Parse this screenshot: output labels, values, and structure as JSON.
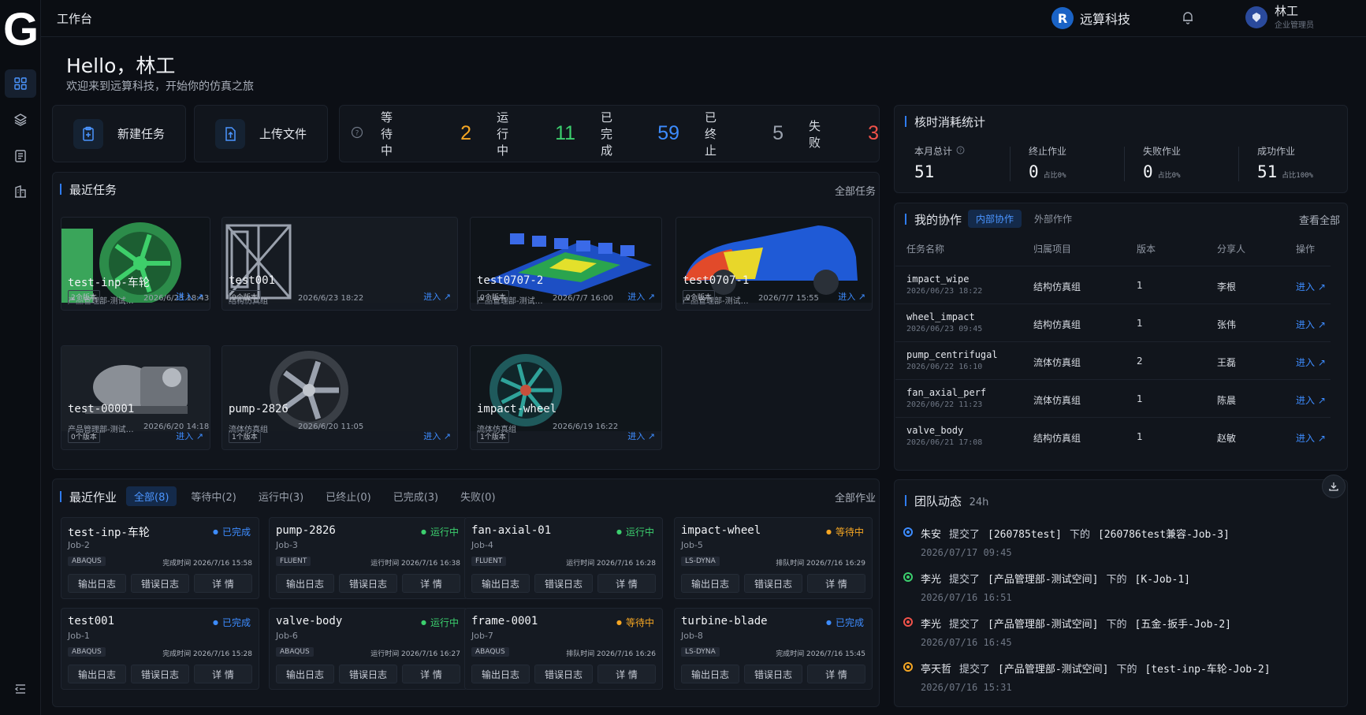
{
  "header": {
    "title": "工作台",
    "brand": "远算科技",
    "brand_logo": "R",
    "user_name": "林工",
    "user_role": "企业管理员"
  },
  "greeting": {
    "hello": "Hello，林工",
    "welcome": "欢迎来到远算科技，开始你的仿真之旅"
  },
  "actions": {
    "new_task": "新建任务",
    "upload": "上传文件"
  },
  "status": [
    {
      "label": "等待中",
      "value": "2",
      "color": "#f5a623"
    },
    {
      "label": "运行中",
      "value": "11",
      "color": "#3ccf6e"
    },
    {
      "label": "已完成",
      "value": "59",
      "color": "#3d8cff"
    },
    {
      "label": "已终止",
      "value": "5",
      "color": "#9aa1ad"
    },
    {
      "label": "失败",
      "value": "3",
      "color": "#f0524a"
    }
  ],
  "recent_tasks": {
    "title": "最近任务",
    "all_link": "全部任务",
    "enter": "进入 ↗",
    "items": [
      {
        "name": "test-inp-车轮",
        "group": "产品管理部-测试…",
        "date": "2026/6/23 18:43",
        "versions": "2个版本"
      },
      {
        "name": "test001",
        "group": "结构仿真组",
        "date": "2026/6/23 18:22",
        "versions": "0个版本"
      },
      {
        "name": "test0707-2",
        "group": "产品管理部-测试…",
        "date": "2026/7/7 16:00",
        "versions": "0个版本"
      },
      {
        "name": "test0707-1",
        "group": "产品管理部-测试…",
        "date": "2026/7/7 15:55",
        "versions": "0个版本"
      },
      {
        "name": "test-00001",
        "group": "产品管理部-测试…",
        "date": "2026/6/20 14:18",
        "versions": "0个版本"
      },
      {
        "name": "pump-2826",
        "group": "流体仿真组",
        "date": "2026/6/20 11:05",
        "versions": "1个版本"
      },
      {
        "name": "impact-wheel",
        "group": "流体仿真组",
        "date": "2026/6/19 16:22",
        "versions": "1个版本"
      }
    ]
  },
  "recent_jobs": {
    "title": "最近作业",
    "all_link": "全部作业",
    "tabs": [
      "全部(8)",
      "等待中(2)",
      "运行中(3)",
      "已终止(0)",
      "已完成(3)",
      "失败(0)"
    ],
    "buttons": {
      "out_log": "输出日志",
      "err_log": "错误日志",
      "detail": "详 情"
    },
    "items": [
      {
        "name": "test-inp-车轮",
        "id": "Job-2",
        "status": "已完成",
        "status_color": "#3d8cff",
        "solver": "ABAQUS",
        "time": "完成时间 2026/7/16 15:58"
      },
      {
        "name": "pump-2826",
        "id": "Job-3",
        "status": "运行中",
        "status_color": "#3ccf6e",
        "solver": "FLUENT",
        "time": "运行时间 2026/7/16 16:38"
      },
      {
        "name": "fan-axial-01",
        "id": "Job-4",
        "status": "运行中",
        "status_color": "#3ccf6e",
        "solver": "FLUENT",
        "time": "运行时间 2026/7/16 16:28"
      },
      {
        "name": "impact-wheel",
        "id": "Job-5",
        "status": "等待中",
        "status_color": "#f5a623",
        "solver": "LS-DYNA",
        "time": "排队时间 2026/7/16 16:29"
      },
      {
        "name": "test001",
        "id": "Job-1",
        "status": "已完成",
        "status_color": "#3d8cff",
        "solver": "ABAQUS",
        "time": "完成时间 2026/7/16 15:28"
      },
      {
        "name": "valve-body",
        "id": "Job-6",
        "status": "运行中",
        "status_color": "#3ccf6e",
        "solver": "ABAQUS",
        "time": "运行时间 2026/7/16 16:27"
      },
      {
        "name": "frame-0001",
        "id": "Job-7",
        "status": "等待中",
        "status_color": "#f5a623",
        "solver": "ABAQUS",
        "time": "排队时间 2026/7/16 16:26"
      },
      {
        "name": "turbine-blade",
        "id": "Job-8",
        "status": "已完成",
        "status_color": "#3d8cff",
        "solver": "LS-DYNA",
        "time": "完成时间 2026/7/16 15:45"
      }
    ]
  },
  "core_hours": {
    "title": "核时消耗统计",
    "items": [
      {
        "label": "本月总计",
        "value": "51",
        "share": ""
      },
      {
        "label": "终止作业",
        "value": "0",
        "share": "占比0%"
      },
      {
        "label": "失败作业",
        "value": "0",
        "share": "占比0%"
      },
      {
        "label": "成功作业",
        "value": "51",
        "share": "占比100%"
      }
    ]
  },
  "collab": {
    "title": "我的协作",
    "tab_internal": "内部协作",
    "tab_external": "外部作作",
    "view_all": "查看全部",
    "headers": [
      "任务名称",
      "归属项目",
      "版本",
      "分享人",
      "操作"
    ],
    "enter": "进入 ↗",
    "rows": [
      {
        "name": "impact_wipe",
        "date": "2026/06/23 18:22",
        "project": "结构仿真组",
        "version": "1",
        "sharer": "李根"
      },
      {
        "name": "wheel_impact",
        "date": "2026/06/23 09:45",
        "project": "结构仿真组",
        "version": "1",
        "sharer": "张伟"
      },
      {
        "name": "pump_centrifugal",
        "date": "2026/06/22 16:10",
        "project": "流体仿真组",
        "version": "2",
        "sharer": "王磊"
      },
      {
        "name": "fan_axial_perf",
        "date": "2026/06/22 11:23",
        "project": "流体仿真组",
        "version": "1",
        "sharer": "陈晨"
      },
      {
        "name": "valve_body",
        "date": "2026/06/21 17:08",
        "project": "结构仿真组",
        "version": "1",
        "sharer": "赵敏"
      }
    ]
  },
  "team": {
    "title": "团队动态",
    "range": "24h",
    "items": [
      {
        "user": "朱安",
        "verb": "提交了",
        "space": "[260785test]",
        "under": "下的",
        "job": "[260786test兼容-Job-3]",
        "time": "2026/07/17 09:45",
        "color": "#3d8cff"
      },
      {
        "user": "李光",
        "verb": "提交了",
        "space": "[产品管理部-测试空间]",
        "under": "下的",
        "job": "[K-Job-1]",
        "time": "2026/07/16 16:51",
        "color": "#3ccf6e"
      },
      {
        "user": "李光",
        "verb": "提交了",
        "space": "[产品管理部-测试空间]",
        "under": "下的",
        "job": "[五金-扳手-Job-2]",
        "time": "2026/07/16 16:45",
        "color": "#f0524a"
      },
      {
        "user": "亭天哲",
        "verb": "提交了",
        "space": "[产品管理部-测试空间]",
        "under": "下的",
        "job": "[test-inp-车轮-Job-2]",
        "time": "2026/07/16 15:31",
        "color": "#f5a623"
      }
    ]
  }
}
